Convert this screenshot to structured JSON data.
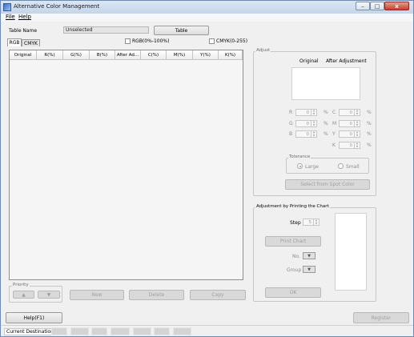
{
  "window": {
    "title": "Alternative Color Management"
  },
  "titlebar_buttons": {
    "minimize": "–",
    "maximize": "□",
    "close": "x"
  },
  "menu": {
    "file": "File",
    "help": "Help"
  },
  "table_name": {
    "label": "Table Name",
    "value": "Unselected",
    "button": "Table"
  },
  "tabs": [
    "RGB",
    "CMYK"
  ],
  "checkboxes": {
    "rgb": "RGB(0%-100%)",
    "cmyk": "CMYK(0-255)"
  },
  "table": {
    "columns": [
      "Original",
      "R(%)",
      "G(%)",
      "B(%)",
      "After Ad...",
      "C(%)",
      "M(%)",
      "Y(%)",
      "K(%)"
    ]
  },
  "priority": {
    "title": "Priority",
    "up": "▲",
    "down": "▼"
  },
  "actions": {
    "new": "New",
    "delete": "Delete",
    "copy": "Copy"
  },
  "adjust": {
    "title": "Adjust",
    "original": "Original",
    "after": "After Adjustment",
    "fields": [
      {
        "label": "R",
        "value": "0",
        "unit": "%"
      },
      {
        "label": "G",
        "value": "0",
        "unit": "%"
      },
      {
        "label": "B",
        "value": "0",
        "unit": "%"
      },
      {
        "label": "C",
        "value": "0",
        "unit": "%"
      },
      {
        "label": "M",
        "value": "0",
        "unit": "%"
      },
      {
        "label": "Y",
        "value": "0",
        "unit": "%"
      },
      {
        "label": "K",
        "value": "0",
        "unit": "%"
      }
    ],
    "tolerance": {
      "title": "Tolerance",
      "large": "Large",
      "small": "Small"
    },
    "spot_button": "Select from Spot Color"
  },
  "chart": {
    "title": "Adjustment by Printing the Chart",
    "step_label": "Step",
    "step_value": "5",
    "print_button": "Print Chart",
    "no_label": "No.",
    "group_label": "Group",
    "combo_arrow": "▼",
    "ok_button": "OK"
  },
  "footer": {
    "help_button": "Help(F1)",
    "register_button": "Register"
  },
  "status": {
    "current_destination": "Current Destination"
  },
  "spin_arrows": {
    "up": "▲",
    "down": "▼"
  }
}
